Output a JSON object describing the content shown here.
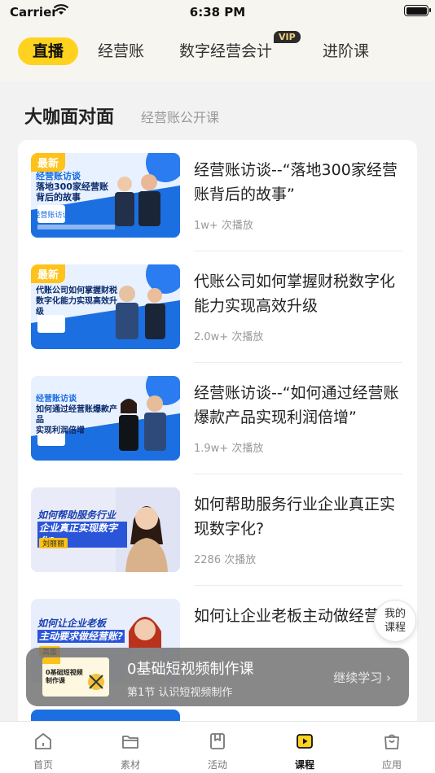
{
  "status_bar": {
    "carrier": "Carrier",
    "time": "6:38 PM"
  },
  "top_tabs": [
    {
      "label": "直播",
      "active": true
    },
    {
      "label": "经营账"
    },
    {
      "label": "数字经营会计",
      "badge": "VIP"
    },
    {
      "label": "进阶课"
    }
  ],
  "section": {
    "title": "大咖面对面",
    "subtitle": "经营账公开课"
  },
  "courses": [
    {
      "chip": "最新",
      "title": "经营账访谈--“落地300家经营账背后的故事”",
      "plays": "1w+ 次播放",
      "thumb_text": [
        "经营账访谈",
        "落地300家经营账",
        "背后的故事"
      ]
    },
    {
      "chip": "最新",
      "title": "代账公司如何掌握财税数字化能力实现高效升级",
      "plays": "2.0w+ 次播放",
      "thumb_text": [
        "代账公司如何掌握财税",
        "数字化能力实现高效升级"
      ]
    },
    {
      "chip": "",
      "title": "经营账访谈--“如何通过经营账爆款产品实现利润倍增”",
      "plays": "1.9w+ 次播放",
      "thumb_text": [
        "经营账访谈",
        "如何通过经营账爆款产品",
        "实现利润倍增"
      ]
    },
    {
      "chip": "",
      "title": "如何帮助服务行业企业真正实现数字化?",
      "plays": "2286 次播放",
      "thumb_text": [
        "如何帮助服务行业",
        "企业真正实现数字化?",
        "刘丽丽"
      ]
    },
    {
      "chip": "",
      "title": "如何让企业老板主动做经营账",
      "plays": "",
      "thumb_text": [
        "如何让企业老板",
        "主动要求做经营账?",
        "高蕾"
      ]
    }
  ],
  "my_course": {
    "line1": "我的",
    "line2": "课程"
  },
  "mini_player": {
    "title": "0基础短视频制作课",
    "subtitle": "第1节 认识短视频制作",
    "continue": "继续学习 ›",
    "thumb_text": "0基础短视频制作课"
  },
  "bottom_nav": [
    {
      "label": "首页",
      "icon": "home-icon"
    },
    {
      "label": "素材",
      "icon": "folder-icon"
    },
    {
      "label": "活动",
      "icon": "bookmark-icon"
    },
    {
      "label": "课程",
      "icon": "play-icon",
      "active": true
    },
    {
      "label": "应用",
      "icon": "bag-icon"
    }
  ],
  "colors": {
    "accent": "#ffd21f",
    "chip": "#ffc21a",
    "thumb_blue": "#1c6fe0"
  }
}
